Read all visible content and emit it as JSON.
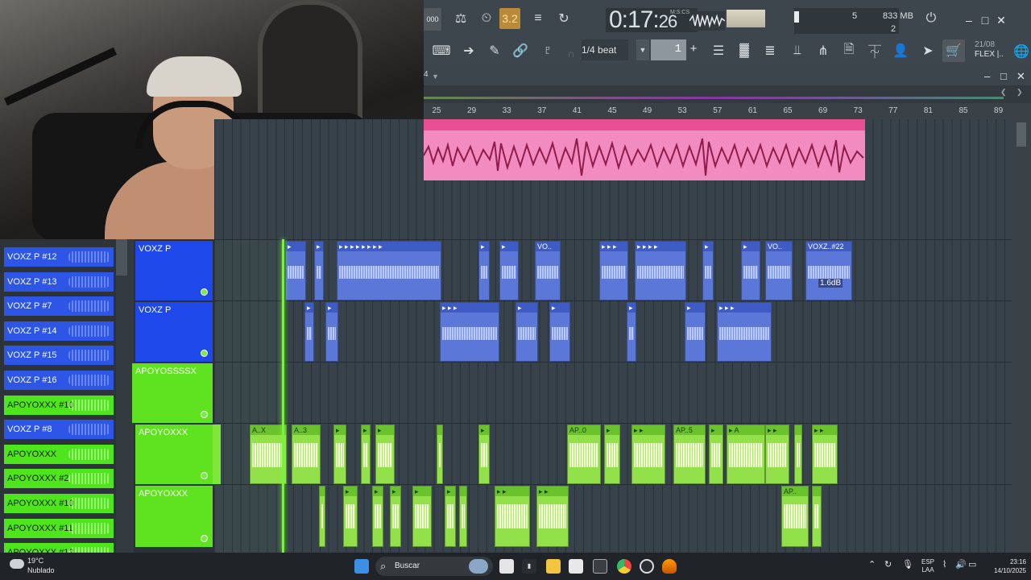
{
  "window": {
    "time_main": "0:17:",
    "time_cs": "26",
    "time_unit": "M:S:CS",
    "tempo_badge": "3.2",
    "cpu_value": "5",
    "memory": "833 MB",
    "poly": "2",
    "pattern_label": "000"
  },
  "snap": {
    "value": "1/4 beat",
    "step": "1"
  },
  "news": {
    "date": "21/08",
    "title": "FLEX |.."
  },
  "playlist": {
    "arrangement_marker": "4"
  },
  "ruler_ticks": [
    "25",
    "29",
    "33",
    "37",
    "41",
    "45",
    "49",
    "53",
    "57",
    "61",
    "65",
    "69",
    "73",
    "77",
    "81",
    "85",
    "89"
  ],
  "tracks": [
    {
      "name": "VOXZ P",
      "color": "blue"
    },
    {
      "name": "VOXZ P",
      "color": "blue"
    },
    {
      "name": "APOYOSSSSX",
      "color": "green"
    },
    {
      "name": "APOYOXXX",
      "color": "green"
    },
    {
      "name": "APOYOXXX",
      "color": "green"
    }
  ],
  "clip_labels": {
    "vo1": "VO..",
    "vo2": "VO..",
    "voxz22": "VOXZ..#22",
    "db": "1.6dB",
    "ax": "A..X",
    "a3": "A..3",
    "ap0": "AP..0",
    "ap5": "AP..5",
    "a": "A",
    "ap": "AP.."
  },
  "channels": [
    {
      "name": "VOXZ P #12",
      "color": "blue"
    },
    {
      "name": "VOXZ P #13",
      "color": "blue"
    },
    {
      "name": "VOXZ P #7",
      "color": "blue"
    },
    {
      "name": "VOXZ P #14",
      "color": "blue"
    },
    {
      "name": "VOXZ P #15",
      "color": "blue"
    },
    {
      "name": "VOXZ P #16",
      "color": "blue"
    },
    {
      "name": "APOYOXXX #10",
      "color": "green"
    },
    {
      "name": "VOXZ P #8",
      "color": "blue"
    },
    {
      "name": "APOYOXXX",
      "color": "green"
    },
    {
      "name": "APOYOXXX #2",
      "color": "green"
    },
    {
      "name": "APOYOXXX #10",
      "color": "green"
    },
    {
      "name": "APOYOXXX #11",
      "color": "green"
    },
    {
      "name": "APOYOXXX #12",
      "color": "green"
    }
  ],
  "taskbar": {
    "temp": "19°C",
    "weather": "Nublado",
    "search": "Buscar",
    "lang1": "ESP",
    "lang2": "LAA",
    "time": "23:16",
    "date": "14/10/2025"
  },
  "colors": {
    "blue_track": "#1e48ea",
    "green_track": "#5fe21f",
    "audio_clip": "#f28cc0",
    "playhead": "#7cf03e"
  }
}
